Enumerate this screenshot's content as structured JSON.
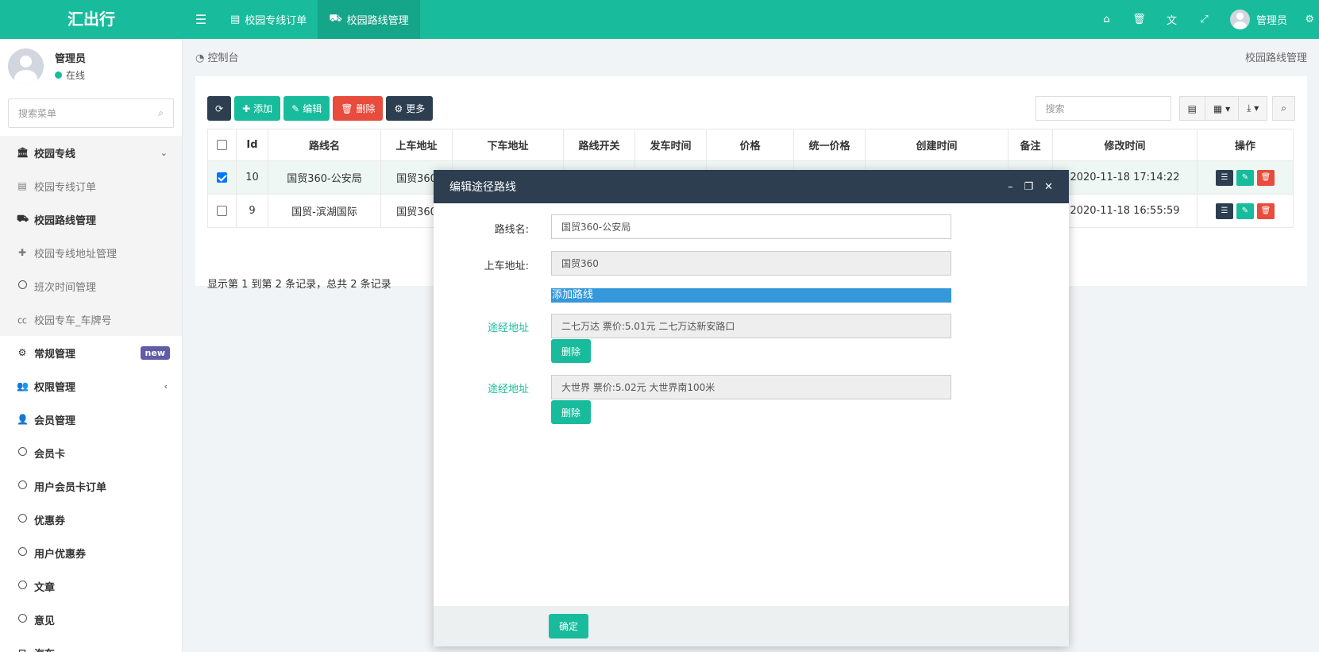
{
  "app": {
    "logo": "汇出行"
  },
  "header": {
    "tabs": [
      {
        "label": "校园专线订单",
        "icon": "list-icon"
      },
      {
        "label": "校园路线管理",
        "icon": "truck-icon"
      }
    ],
    "user_name": "管理员"
  },
  "sidebar": {
    "user": {
      "name": "管理员",
      "status": "在线"
    },
    "search_placeholder": "搜索菜单",
    "group_title": "校园专线",
    "sub_items": [
      {
        "label": "校园专线订单",
        "icon": "list-icon"
      },
      {
        "label": "校园路线管理",
        "icon": "truck-icon"
      },
      {
        "label": "校园专线地址管理",
        "icon": "plus-icon"
      },
      {
        "label": "班次时间管理",
        "icon": "circle-icon"
      },
      {
        "label": "校园专车_车牌号",
        "icon": "cc-icon"
      }
    ],
    "items": [
      {
        "label": "常规管理",
        "icon": "cogs-icon",
        "badge": "new"
      },
      {
        "label": "权限管理",
        "icon": "group-icon"
      },
      {
        "label": "会员管理",
        "icon": "user-icon"
      },
      {
        "label": "会员卡",
        "icon": "circle-icon"
      },
      {
        "label": "用户会员卡订单",
        "icon": "circle-icon"
      },
      {
        "label": "优惠券",
        "icon": "circle-icon"
      },
      {
        "label": "用户优惠券",
        "icon": "circle-icon"
      },
      {
        "label": "文章",
        "icon": "circle-icon"
      },
      {
        "label": "意见",
        "icon": "circle-icon"
      },
      {
        "label": "汽车",
        "icon": "car-icon"
      }
    ]
  },
  "breadcrumb": {
    "left": "控制台",
    "right": "校园路线管理"
  },
  "toolbar": {
    "add": "添加",
    "edit": "编辑",
    "delete": "删除",
    "more": "更多",
    "search_placeholder": "搜索"
  },
  "table": {
    "columns": [
      "Id",
      "路线名",
      "上车地址",
      "下车地址",
      "路线开关",
      "发车时间",
      "价格",
      "统一价格",
      "创建时间",
      "备注",
      "修改时间",
      "操作"
    ],
    "rows": [
      {
        "checked": true,
        "id": "10",
        "name": "国贸360-公安局",
        "pickup": "国贸360",
        "modified": "2020-11-18 17:14:22"
      },
      {
        "checked": false,
        "id": "9",
        "name": "国贸-滨湖国际",
        "pickup": "国贸360",
        "modified": "2020-11-18 16:55:59"
      }
    ],
    "footer": "显示第 1 到第 2 条记录，总共 2 条记录"
  },
  "modal": {
    "title": "编辑途径路线",
    "route_name_label": "路线名:",
    "route_name_value": "国贸360-公安局",
    "pickup_label": "上车地址:",
    "pickup_value": "国贸360",
    "add_route": "添加路线",
    "via_label": "途经地址",
    "via": [
      {
        "value": "二七万达   票价:5.01元  二七万达新安路口",
        "delete": "删除"
      },
      {
        "value": "大世界   票价:5.02元  大世界南100米",
        "delete": "删除"
      }
    ],
    "ok": "确定"
  },
  "colors": {
    "primary": "#18bc9c",
    "dark": "#2c3e50",
    "danger": "#e74c3c",
    "info": "#3498db",
    "badge": "#605ca8"
  }
}
